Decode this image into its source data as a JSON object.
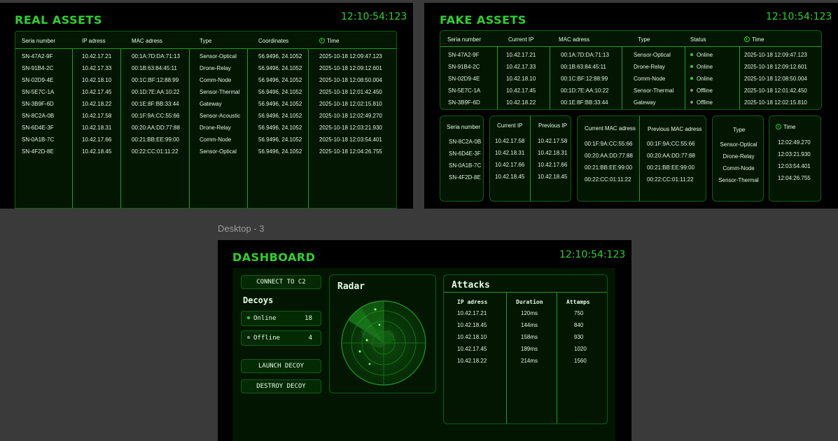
{
  "real": {
    "title": "REAL ASSETS",
    "clock": "12:10:54:123",
    "headers": [
      "Seria number",
      "IP adress",
      "MAC adress",
      "Type",
      "Coordinates",
      "Time"
    ],
    "rows": [
      [
        "SN-47A2-9F",
        "10.42.17.21",
        "00:1A:7D:DA:71:13",
        "Sensor-Optical",
        "56.9496, 24.1052",
        "2025-10-18 12:09:47.123"
      ],
      [
        "SN-91B4-2C",
        "10.42.17.33",
        "00:1B:63:84:45:11",
        "Drone-Relay",
        "56.9496, 24.1052",
        "2025-10-18 12:09:12.601"
      ],
      [
        "SN-02D9-4E",
        "10.42.18.10",
        "00:1C:BF:12:88:99",
        "Comm-Node",
        "56.9496, 24.1052",
        "2025-10-18 12:08:50.004"
      ],
      [
        "SN-5E7C-1A",
        "10.42.17.45",
        "00:1D:7E:AA:10:22",
        "Sensor-Thermal",
        "56.9496, 24.1052",
        "2025-10-18 12:01:42.450"
      ],
      [
        "SN-3B9F-6D",
        "10.42.18.22",
        "00:1E:8F:BB:33:44",
        "Gateway",
        "56.9496, 24.1052",
        "2025-10-18 12:02:15.810"
      ],
      [
        "SN-8C2A-0B",
        "10.42.17.58",
        "00:1F:9A:CC:55:66",
        "Sensor-Acoustic",
        "56.9496, 24.1052",
        "2025-10-18 12:02:49.270"
      ],
      [
        "SN-6D4E-3F",
        "10.42.18.31",
        "00:20:AA:DD:77:88",
        "Drone-Relay",
        "56.9496, 24.1052",
        "2025-10-18 12:03:21.930"
      ],
      [
        "SN-0A1B-7C",
        "10.42.17.66",
        "00:21:BB:EE:99:00",
        "Comm-Node",
        "56.9496, 24.1052",
        "2025-10-18 12:03:54.401"
      ],
      [
        "SN-4F2D-8E",
        "10.42.18.45",
        "00:22:CC:01:11:22",
        "Sensor-Optical",
        "56.9496, 24.1052",
        "2025-10-18 12:04:26.755"
      ]
    ]
  },
  "fake": {
    "title": "FAKE ASSETS",
    "clock": "12:10:54:123",
    "top_headers": [
      "Seria number",
      "Current IP",
      "MAC adress",
      "Type",
      "Status",
      "Time"
    ],
    "top_rows": [
      [
        "SN-47A2-9F",
        "10.42.17.21",
        "00:1A:7D:DA:71:13",
        "Sensor-Optical",
        "Online",
        "2025-10-18 12:09:47.123"
      ],
      [
        "SN-91B4-2C",
        "10.42.17.33",
        "00:1B:63:84:45:11",
        "Drone-Relay",
        "Online",
        "2025-10-18 12:09:12.601"
      ],
      [
        "SN-02D9-4E",
        "10.42.18.10",
        "00:1C:BF:12:88:99",
        "Comm-Node",
        "Online",
        "2025-10-18 12:08:50.004"
      ],
      [
        "SN-5E7C-1A",
        "10.42.17.45",
        "00:1D:7E:AA:10:22",
        "Sensor-Thermal",
        "Offline",
        "2025-10-18 12:01:42.450"
      ],
      [
        "SN-3B9F-6D",
        "10.42.18.22",
        "00:1E:8F:BB:33:44",
        "Gateway",
        "Offline",
        "2025-10-18 12:02:15.810"
      ]
    ],
    "bottom": {
      "serial_header": "Seria number",
      "serials": [
        "SN-8C2A-0B",
        "SN-6D4E-3F",
        "SN-0A1B-7C",
        "SN-4F2D-8E"
      ],
      "current_ip_header": "Current IP",
      "current_ips": [
        "10.42.17.58",
        "10.42.18.31",
        "10.42.17.66",
        "10.42.18.45"
      ],
      "previous_ip_header": "Previous IP",
      "previous_ips": [
        "10.42.17.58",
        "10.42.18.31",
        "10.42.17.66",
        "10.42.18.45"
      ],
      "current_mac_header": "Current MAC adress",
      "current_macs": [
        "00:1F:9A:CC:55:66",
        "00:20:AA:DD:77:88",
        "00:21:BB:EE:99:00",
        "00:22:CC:01:11:22"
      ],
      "previous_mac_header": "Previous MAC adress",
      "previous_macs": [
        "00:1F:9A:CC:55:66",
        "00:20:AA:DD:77:88",
        "00:21:BB:EE:99:00",
        "00:22:CC:01:11:22"
      ],
      "type_header": "Type",
      "types": [
        "Sensor-Optical",
        "Drone-Relay",
        "Comm-Node",
        "Sensor-Thermal"
      ],
      "time_header": "Time",
      "times": [
        "12:02:49.270",
        "12:03:21.930",
        "12:03:54.401",
        "12:04:26.755"
      ]
    }
  },
  "desktop_label": "Desktop - 3",
  "dashboard": {
    "title": "DASHBOARD",
    "clock": "12:10:54:123",
    "connect_label": "CONNECT TO C2",
    "decoys_title": "Decoys",
    "online_label": "Online",
    "online_count": "18",
    "offline_label": "Offline",
    "offline_count": "4",
    "launch_label": "LAUNCH DECOY",
    "destroy_label": "DESTROY DECOY",
    "radar_title": "Radar",
    "attacks_title": "Attacks",
    "attack_headers": [
      "IP adress",
      "Duration",
      "Attamps"
    ],
    "attacks": [
      [
        "10.42.17.21",
        "120ms",
        "750"
      ],
      [
        "10.42.18.45",
        "144ms",
        "840"
      ],
      [
        "10.42.18.10",
        "158ms",
        "930"
      ],
      [
        "10.42.17.45",
        "189ms",
        "1020"
      ],
      [
        "10.42.18.22",
        "214ms",
        "1560"
      ]
    ]
  },
  "colors": {
    "accent": "#2fd12f",
    "panel": "#021602",
    "online": "#2fd12f",
    "offline": "#8a8a8a"
  }
}
